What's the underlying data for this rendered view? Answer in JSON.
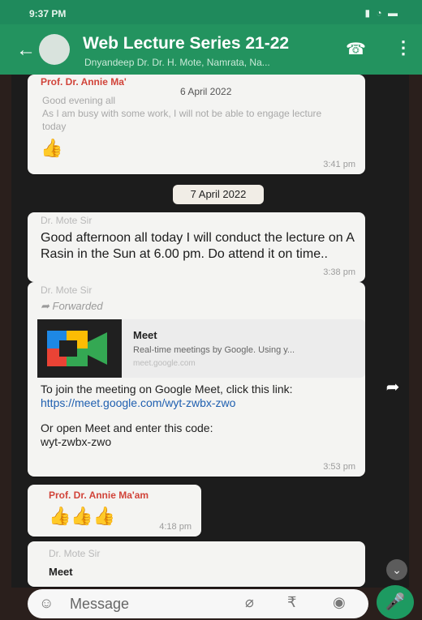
{
  "status": {
    "time": "9:37 PM",
    "system": "▮ ◔ ▬"
  },
  "header": {
    "title": "Web Lecture Series 21-22",
    "subtitle": "Dnyandeep Dr. Dr. H. Mote, Namrata, Na...",
    "back_icon": "arrow-left-icon",
    "call_icon": "add-call-icon",
    "menu_icon": "more-vert-icon"
  },
  "messages": [
    {
      "sender": "Prof. Dr. Annie Ma'",
      "date_inline": "6 April 2022",
      "lines": [
        "Good evening all",
        "As I am busy with some work, I will not be able to engage lecture today"
      ],
      "reaction": "👍",
      "time": "3:41 pm"
    },
    {
      "date_chip": "7 April 2022"
    },
    {
      "sender": "Dr. Mote Sir",
      "text": "Good afternoon all today I will conduct the lecture on A Rasin in the Sun at 6.00 pm. Do attend it on time..",
      "time": "3:38 pm"
    },
    {
      "sender": "Dr. Mote Sir",
      "forwarded": "Forwarded",
      "card_title": "Meet",
      "card_desc": "Real-time meetings by Google. Using y...",
      "card_url": "meet.google.com",
      "body_lines": [
        "To join the meeting on Google Meet, click this link:",
        "https://meet.google.com/wyt-zwbx-zwo",
        "",
        "Or open Meet and enter this code:",
        "wyt-zwbx-zwo"
      ],
      "time": "3:53 pm"
    },
    {
      "sender": "Prof. Dr. Annie Ma'am",
      "reactions": "👍👍👍",
      "time": "4:18 pm"
    },
    {
      "sender": "Dr. Mote Sir",
      "text": "Meet"
    }
  ],
  "composer": {
    "placeholder": "Message",
    "emoji_icon": "emoji-icon",
    "attach_icon": "paperclip-icon",
    "pay_icon": "rupee-icon",
    "camera_icon": "camera-icon",
    "mic_icon": "mic-icon"
  },
  "colors": {
    "accent": "#23935f",
    "bubble": "#f4f4f2",
    "background": "#1c1c1c"
  }
}
